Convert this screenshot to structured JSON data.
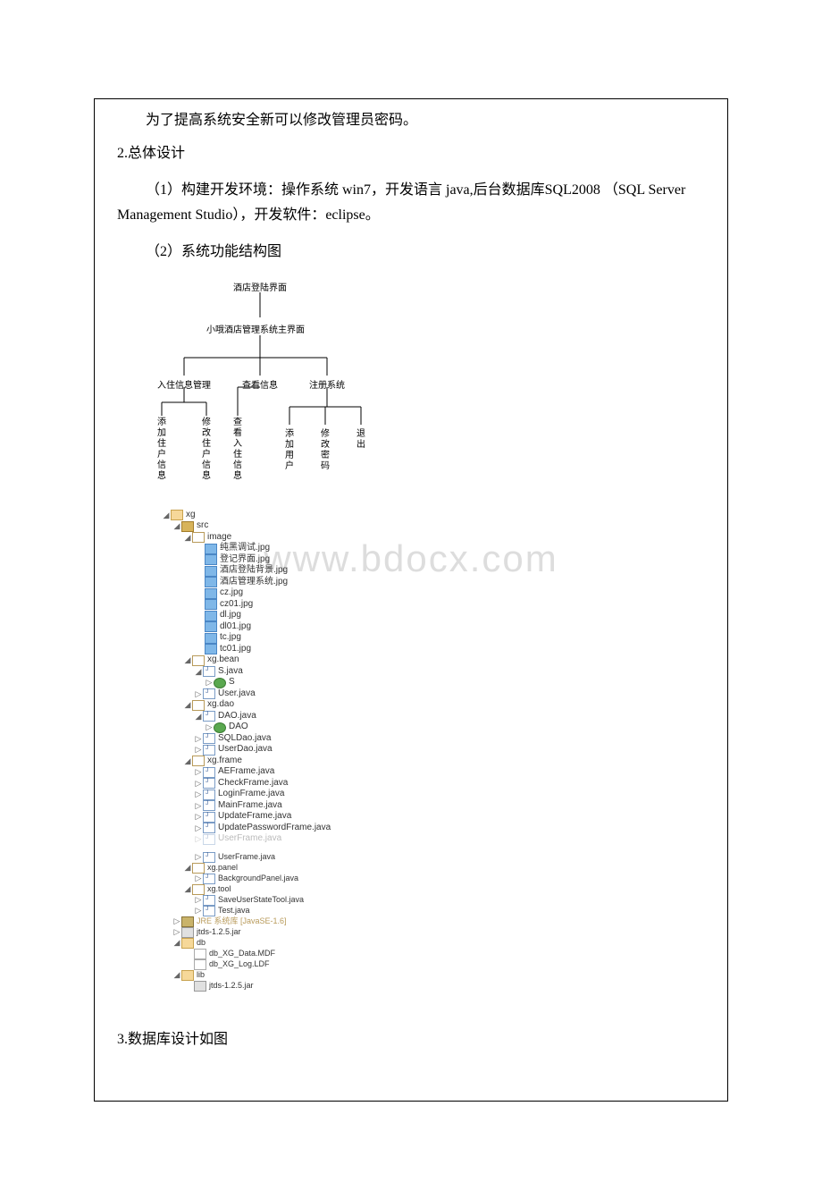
{
  "paragraphs": {
    "p1": "为了提高系统安全新可以修改管理员密码。",
    "p2": "2.总体设计",
    "p3": "（1）构建开发环境：操作系统 win7，开发语言 java,后台数据库SQL2008 （SQL Server Management Studio），开发软件：eclipse。",
    "p4": "（2）系统功能结构图",
    "p5": "3.数据库设计如图"
  },
  "watermark": "www.bdocx.com",
  "diagram": {
    "root": "酒店登陆界面",
    "main": "小哦酒店管理系统主界面",
    "branches": [
      "入住信息管理",
      "查看信息",
      "注册系统"
    ],
    "leaves_col": [
      "添加住户信息",
      "修改住户信息",
      "查看入住信息",
      "添加用户",
      "修改密码",
      "退出"
    ]
  },
  "tree": {
    "root": "xg",
    "src": "src",
    "pkg_image": "image",
    "images": [
      "纯黑调试.jpg",
      "登记界面.jpg",
      "酒店登陆背景.jpg",
      "酒店管理系统.jpg",
      "cz.jpg",
      "cz01.jpg",
      "dl.jpg",
      "dl01.jpg",
      "tc.jpg",
      "tc01.jpg"
    ],
    "pkg_bean": "xg.bean",
    "bean_files": [
      "S.java",
      "S",
      "User.java"
    ],
    "pkg_dao": "xg.dao",
    "dao_files": [
      "DAO.java",
      "DAO",
      "SQLDao.java",
      "UserDao.java"
    ],
    "pkg_frame": "xg.frame",
    "frame_files": [
      "AEFrame.java",
      "CheckFrame.java",
      "LoginFrame.java",
      "MainFrame.java",
      "UpdateFrame.java",
      "UpdatePasswordFrame.java",
      "UserFrame.java"
    ],
    "dim_file": "UserFrame.java",
    "pkg_panel": "xg.panel",
    "panel_files": [
      "BackgroundPanel.java"
    ],
    "pkg_tool": "xg.tool",
    "tool_files": [
      "SaveUserStateTool.java",
      "Test.java"
    ],
    "jre": "JRE 系统库 [JavaSE-1.6]",
    "jar_top": "jtds-1.2.5.jar",
    "db": "db",
    "db_files": [
      "db_XG_Data.MDF",
      "db_XG_Log.LDF"
    ],
    "lib": "lib",
    "lib_files": [
      "jtds-1.2.5.jar"
    ]
  }
}
